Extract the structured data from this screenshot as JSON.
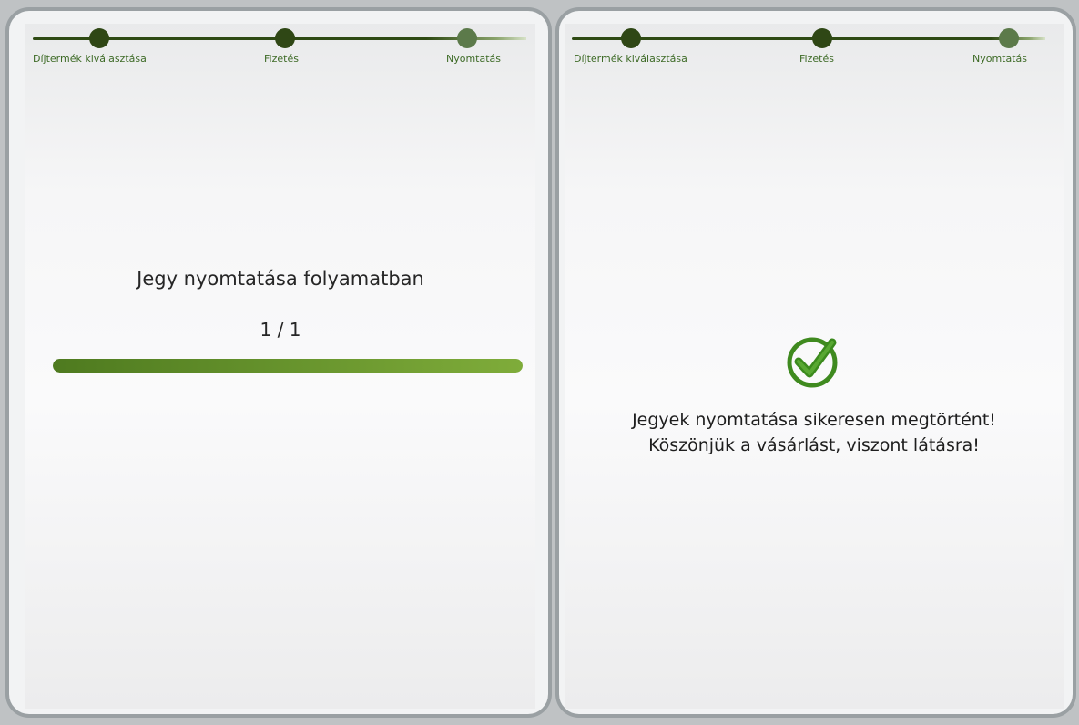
{
  "steps": [
    "Díjtermék kiválasztása",
    "Fizetés",
    "Nyomtatás"
  ],
  "left_panel": {
    "title": "Jegy nyomtatása folyamatban",
    "counter": "1 / 1",
    "progress_fraction": 1.0
  },
  "right_panel": {
    "icon": "check-circle-icon",
    "line1": "Jegyek nyomtatása sikeresen megtörtént!",
    "line2": "Köszönjük a vásárlást, viszont látásra!"
  },
  "colors": {
    "accent": "#3f7a1e",
    "progress": "#6e9b33",
    "dark_green": "#2f4715"
  }
}
